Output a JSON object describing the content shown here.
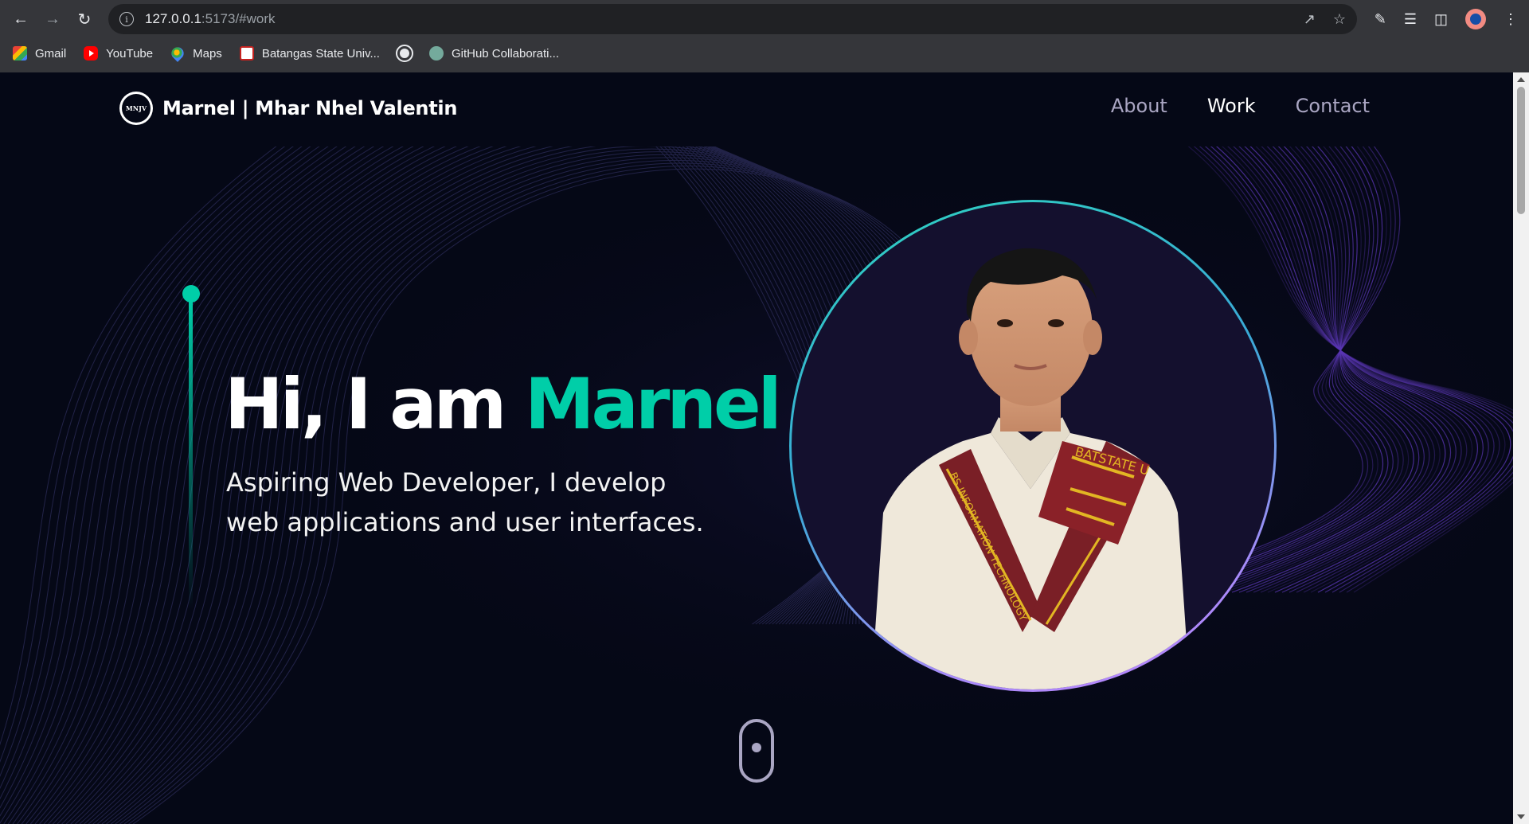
{
  "browser": {
    "url_host": "127.0.0.1",
    "url_path": ":5173/#work",
    "bookmarks": [
      {
        "label": "Gmail",
        "icon": "gmail-icon",
        "color": "#ea4335"
      },
      {
        "label": "YouTube",
        "icon": "youtube-icon",
        "color": "#ff0000"
      },
      {
        "label": "Maps",
        "icon": "maps-icon",
        "color": "#34a853"
      },
      {
        "label": "Batangas State Univ...",
        "icon": "batangas-icon",
        "color": "#c5221f"
      },
      {
        "label": "",
        "icon": "globe-icon",
        "color": "#e8eaed"
      },
      {
        "label": "GitHub Collaborati...",
        "icon": "chatgpt-icon",
        "color": "#74aa9c"
      }
    ]
  },
  "site": {
    "logo_text": "MNJV",
    "brand": "Marnel  | Mhar Nhel Valentin",
    "nav": [
      "About",
      "Work",
      "Contact"
    ],
    "active_nav": "Work",
    "hero": {
      "greeting": "Hi, I am ",
      "name": "Marnel",
      "subtitle_line1": "Aspiring Web Developer, I develop",
      "subtitle_line2": "web applications and user interfaces."
    },
    "sash_text_left": "BS INFORMATION TECHNOLOGY",
    "sash_text_right": "BATSTATE U",
    "colors": {
      "accent": "#00cea8",
      "background": "#050816",
      "nav_text": "#aaa6c3"
    }
  }
}
